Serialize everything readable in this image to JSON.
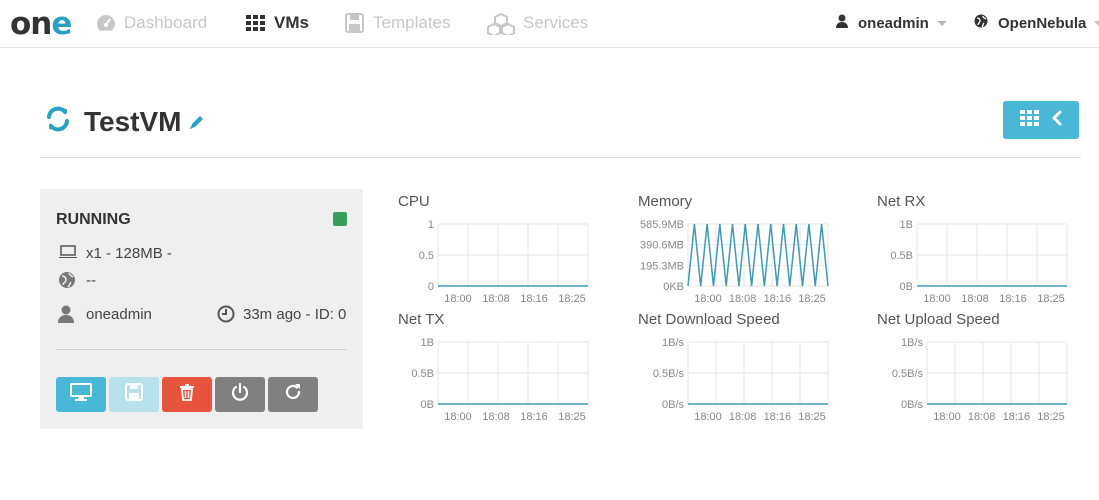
{
  "nav": {
    "logo_prefix": "on",
    "logo_accent": "e",
    "items": [
      {
        "label": "Dashboard",
        "icon": "dashboard-icon",
        "active": false
      },
      {
        "label": "VMs",
        "icon": "grid-icon",
        "active": true
      },
      {
        "label": "Templates",
        "icon": "floppy-icon",
        "active": false
      },
      {
        "label": "Services",
        "icon": "cubes-icon",
        "active": false
      }
    ],
    "user": "oneadmin",
    "zone": "OpenNebula"
  },
  "vm": {
    "name": "TestVM",
    "state": "RUNNING",
    "state_color": "#3a9c5b",
    "capacity": "x1 - 128MB -",
    "ips": "--",
    "owner": "oneadmin",
    "age_id": "33m ago - ID: 0"
  },
  "colors": {
    "accent": "#49b8d6",
    "danger": "#e8533d",
    "line": "#3d9ab8"
  },
  "charts": [
    {
      "title": "CPU",
      "yticks": [
        "1",
        "0.5",
        "0"
      ],
      "xticks": [
        "18:00",
        "18:08",
        "18:16",
        "18:25"
      ],
      "chart_data": {
        "type": "line",
        "x": [
          "18:00",
          "18:08",
          "18:16",
          "18:25"
        ],
        "series": [
          {
            "values": [
              0,
              0,
              0,
              0
            ]
          }
        ],
        "ylim": [
          0,
          1
        ]
      }
    },
    {
      "title": "Memory",
      "yticks": [
        "585.9MB",
        "390.6MB",
        "195.3MB",
        "0KB"
      ],
      "xticks": [
        "18:00",
        "18:08",
        "18:16",
        "18:25"
      ],
      "chart_data": {
        "type": "line",
        "ylim": [
          0,
          585.9
        ],
        "yunit": "MB",
        "series": [
          {
            "values": [
              0,
              585.9,
              0,
              585.9,
              0,
              585.9,
              0,
              585.9,
              0,
              585.9,
              0,
              585.9,
              0,
              585.9,
              0,
              585.9,
              0,
              585.9,
              0,
              585.9,
              0,
              585.9,
              0
            ]
          }
        ]
      }
    },
    {
      "title": "Net RX",
      "yticks": [
        "1B",
        "0.5B",
        "0B"
      ],
      "xticks": [
        "18:00",
        "18:08",
        "18:16",
        "18:25"
      ],
      "chart_data": {
        "type": "line",
        "x": [
          "18:00",
          "18:08",
          "18:16",
          "18:25"
        ],
        "series": [
          {
            "values": [
              0,
              0,
              0,
              0
            ]
          }
        ],
        "ylim": [
          0,
          1
        ]
      }
    },
    {
      "title": "Net TX",
      "yticks": [
        "1B",
        "0.5B",
        "0B"
      ],
      "xticks": [
        "18:00",
        "18:08",
        "18:16",
        "18:25"
      ],
      "chart_data": {
        "type": "line",
        "x": [
          "18:00",
          "18:08",
          "18:16",
          "18:25"
        ],
        "series": [
          {
            "values": [
              0,
              0,
              0,
              0
            ]
          }
        ],
        "ylim": [
          0,
          1
        ]
      }
    },
    {
      "title": "Net Download Speed",
      "yticks": [
        "1B/s",
        "0.5B/s",
        "0B/s"
      ],
      "xticks": [
        "18:00",
        "18:08",
        "18:16",
        "18:25"
      ],
      "chart_data": {
        "type": "line",
        "x": [
          "18:00",
          "18:08",
          "18:16",
          "18:25"
        ],
        "series": [
          {
            "values": [
              0,
              0,
              0,
              0
            ]
          }
        ],
        "ylim": [
          0,
          1
        ]
      }
    },
    {
      "title": "Net Upload Speed",
      "yticks": [
        "1B/s",
        "0.5B/s",
        "0B/s"
      ],
      "xticks": [
        "18:00",
        "18:08",
        "18:16",
        "18:25"
      ],
      "chart_data": {
        "type": "line",
        "x": [
          "18:00",
          "18:08",
          "18:16",
          "18:25"
        ],
        "series": [
          {
            "values": [
              0,
              0,
              0,
              0
            ]
          }
        ],
        "ylim": [
          0,
          1
        ]
      }
    }
  ]
}
